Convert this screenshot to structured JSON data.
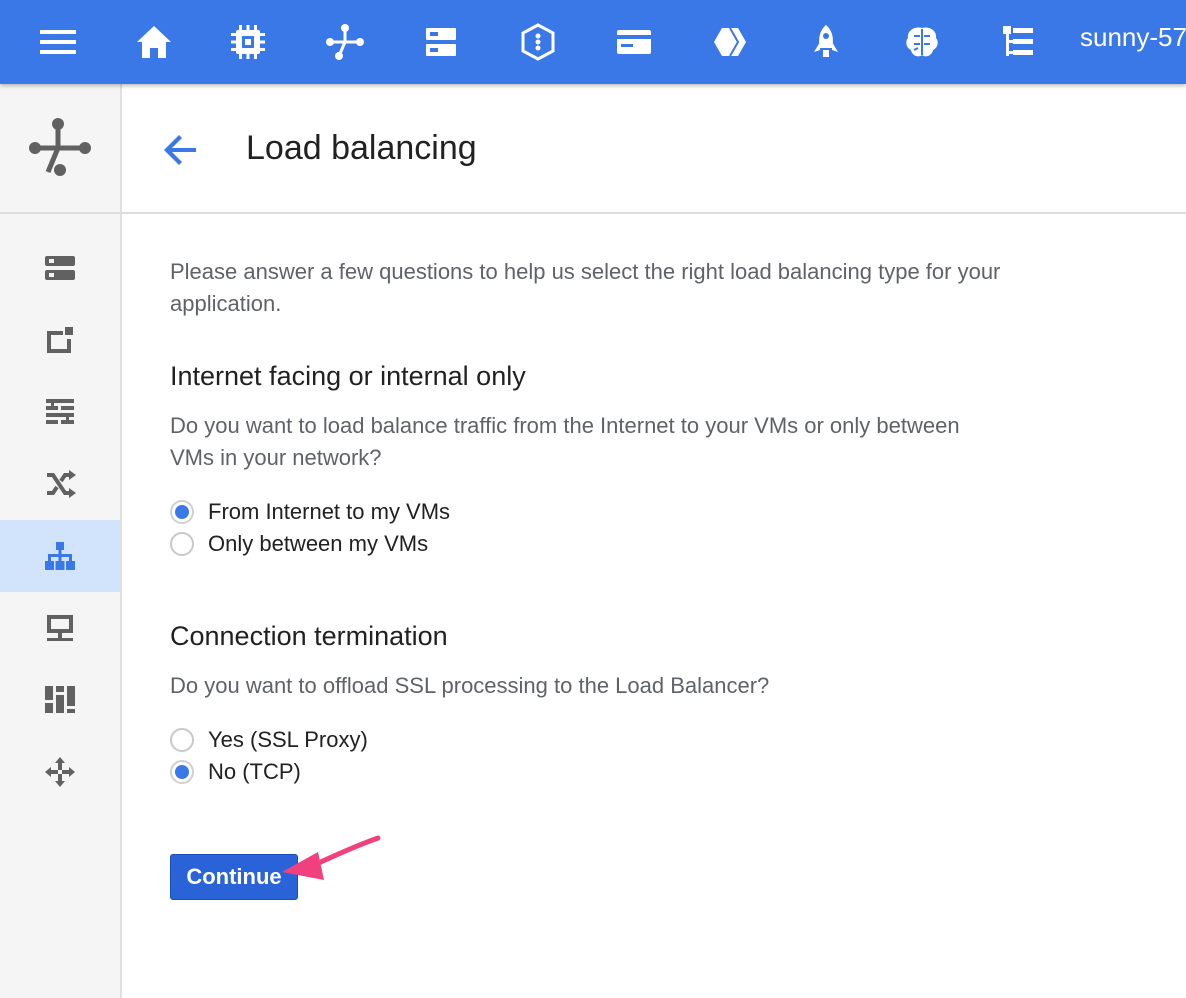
{
  "topbar": {
    "menu_icon": "hamburger-menu-icon",
    "nav_icons": [
      "home-icon",
      "compute-chip-icon",
      "network-icon",
      "storage-icon",
      "dataproc-icon",
      "billing-card-icon",
      "deployment-icon",
      "launcher-rocket-icon",
      "ml-brain-icon",
      "hierarchy-list-icon"
    ],
    "user": "sunny-57"
  },
  "rail": {
    "header_icon": "network-services-icon",
    "items": [
      {
        "icon": "vpc-networks-icon",
        "active": false
      },
      {
        "icon": "external-ip-icon",
        "active": false
      },
      {
        "icon": "firewall-icon",
        "active": false
      },
      {
        "icon": "routes-icon",
        "active": false
      },
      {
        "icon": "load-balancing-icon",
        "active": true
      },
      {
        "icon": "vpn-icon",
        "active": false
      },
      {
        "icon": "cloud-dns-icon",
        "active": false
      },
      {
        "icon": "interconnect-icon",
        "active": false
      }
    ]
  },
  "header": {
    "back_icon": "back-arrow-icon",
    "title": "Load balancing"
  },
  "content": {
    "intro": "Please answer a few questions to help us select the right load balancing type for your application.",
    "section1": {
      "title": "Internet facing or internal only",
      "question": "Do you want to load balance traffic from the Internet to your VMs or only between VMs in your network?",
      "options": [
        {
          "label": "From Internet to my VMs",
          "checked": true
        },
        {
          "label": "Only between my VMs",
          "checked": false
        }
      ]
    },
    "section2": {
      "title": "Connection termination",
      "question": "Do you want to offload SSL processing to the Load Balancer?",
      "options": [
        {
          "label": "Yes (SSL Proxy)",
          "checked": false
        },
        {
          "label": "No (TCP)",
          "checked": true
        }
      ]
    },
    "continue_label": "Continue"
  },
  "colors": {
    "topbar": "#3b78e7",
    "accent": "#3b78e7",
    "button": "#2a63d8",
    "annotation_arrow": "#f0417e",
    "active_rail": "#d2e3fc"
  }
}
